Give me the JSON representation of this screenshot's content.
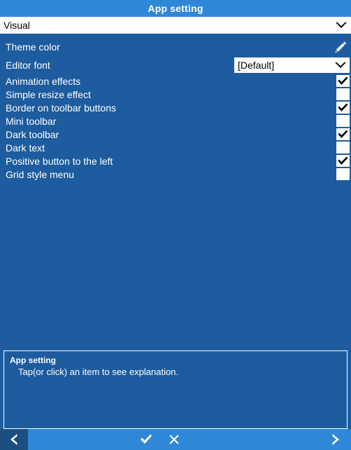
{
  "window": {
    "title": "App setting"
  },
  "category": {
    "selected": "Visual",
    "icon": "chevron-down-icon"
  },
  "settings": [
    {
      "label": "Theme color",
      "control": "pencil",
      "icon": "pencil-icon"
    },
    {
      "label": "Editor font",
      "control": "select",
      "value": "[Default]",
      "icon": "chevron-down-icon"
    },
    {
      "label": "Animation effects",
      "control": "checkbox",
      "checked": true
    },
    {
      "label": "Simple resize effect",
      "control": "checkbox",
      "checked": false
    },
    {
      "label": "Border on toolbar buttons",
      "control": "checkbox",
      "checked": true
    },
    {
      "label": "Mini toolbar",
      "control": "checkbox",
      "checked": false
    },
    {
      "label": "Dark toolbar",
      "control": "checkbox",
      "checked": true
    },
    {
      "label": "Dark text",
      "control": "checkbox",
      "checked": false
    },
    {
      "label": "Positive button to the left",
      "control": "checkbox",
      "checked": true
    },
    {
      "label": "Grid style menu",
      "control": "checkbox",
      "checked": false
    }
  ],
  "explanation": {
    "title": "App setting",
    "body": "Tap(or click) an item to see explanation."
  },
  "toolbar": {
    "back": "back-chevron-icon",
    "confirm": "check-icon",
    "cancel": "close-icon",
    "next": "forward-chevron-icon"
  },
  "colors": {
    "titlebar": "#2f87d8",
    "body": "#1d5c9e",
    "toolbar": "#2f87d8",
    "back_button": "#1b4f82",
    "field_bg": "#ffffff",
    "text": "#ffffff"
  }
}
